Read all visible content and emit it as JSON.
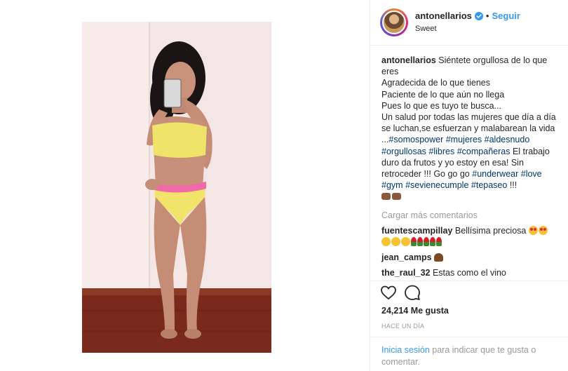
{
  "post": {
    "username": "antonellarios",
    "follow_label": "Seguir",
    "separator": "•",
    "location": "Sweet",
    "media_alt": "Photo of a woman in yellow and pink swimsuit taking a mirror selfie"
  },
  "caption": {
    "username": "antonellarios",
    "lines": [
      "Siéntete orgullosa de lo que eres",
      "Agradecida de lo que tienes",
      "Paciente de lo que aún no llega",
      "Pues lo que es tuyo te busca...",
      "Un salud por todas las mujeres que día a día se luchan,se esfuerzan y malabarean la vida ..."
    ],
    "tags_1": [
      "#somospower",
      "#mujeres",
      "#aldesnudo",
      "#orgullosas",
      "#libres",
      "#compañeras"
    ],
    "line_after_tags": "El trabajo duro da frutos y yo estoy en esa! Sin retroceder !!! Go go go",
    "tags_2": [
      "#underwear",
      "#love",
      "#gym",
      "#sevienecumple",
      "#tepaseo"
    ],
    "ending": "!!!"
  },
  "load_more_label": "Cargar más comentarios",
  "comments": [
    {
      "username": "fuentescampillay",
      "text": "Bellísima preciosa"
    },
    {
      "username": "jean_camps",
      "text": ""
    },
    {
      "username": "the_raul_32",
      "text": "Estas como el vino"
    }
  ],
  "likes": "24,214 Me gusta",
  "time": "HACE UN DÍA",
  "login": {
    "link": "Inicia sesión",
    "rest": "para indicar que te gusta o comentar."
  },
  "icons": {
    "like": "heart-outline-icon",
    "comment": "speech-bubble-icon",
    "verified": "verified-badge-icon"
  },
  "colors": {
    "link_blue": "#3897f0",
    "hashtag": "#003569",
    "muted": "#999999",
    "text": "#262626"
  }
}
